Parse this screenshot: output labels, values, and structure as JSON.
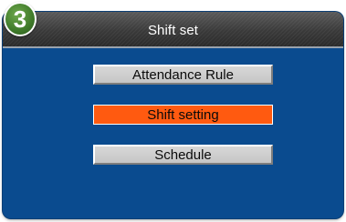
{
  "badge": {
    "number": "3"
  },
  "window": {
    "title": "Shift set"
  },
  "menu": {
    "items": [
      {
        "label": "Attendance Rule",
        "selected": false
      },
      {
        "label": "Shift setting",
        "selected": true
      },
      {
        "label": "Schedule",
        "selected": false
      }
    ]
  },
  "colors": {
    "background": "#0a4b8f",
    "selected_item": "#ff5a10",
    "normal_item": "#cfcfcf",
    "badge": "#3f7a2a"
  }
}
